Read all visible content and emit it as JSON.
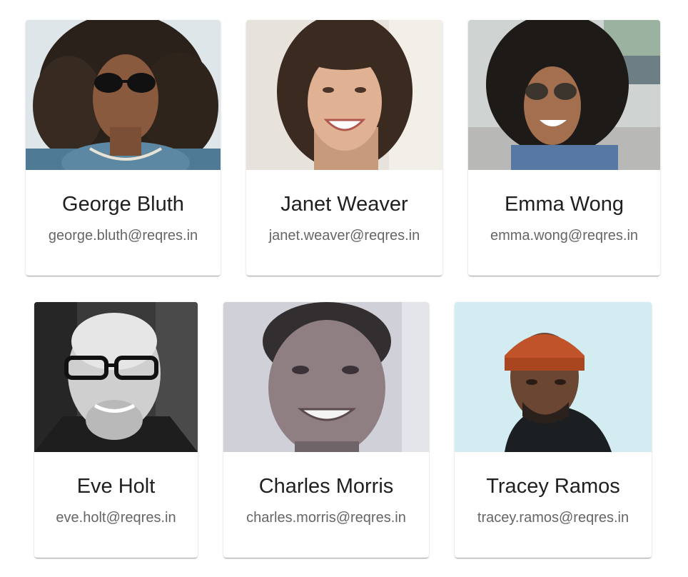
{
  "users": [
    {
      "name": "George Bluth",
      "email": "george.bluth@reqres.in"
    },
    {
      "name": "Janet Weaver",
      "email": "janet.weaver@reqres.in"
    },
    {
      "name": "Emma Wong",
      "email": "emma.wong@reqres.in"
    },
    {
      "name": "Eve Holt",
      "email": "eve.holt@reqres.in"
    },
    {
      "name": "Charles Morris",
      "email": "charles.morris@reqres.in"
    },
    {
      "name": "Tracey Ramos",
      "email": "tracey.ramos@reqres.in"
    }
  ],
  "colors": {
    "card_background": "#ffffff",
    "name_text": "#1f1f1f",
    "email_text": "#666666"
  }
}
